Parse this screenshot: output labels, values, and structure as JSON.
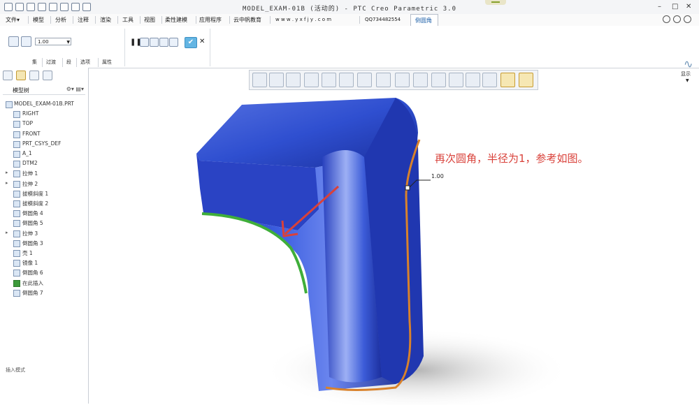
{
  "window": {
    "title": "MODEL_EXAM-01B (活动的) - PTC Creo Parametric 3.0",
    "controls": [
      "–",
      "□",
      "✕"
    ]
  },
  "menu": {
    "items": [
      "文件▾",
      "模型",
      "分析",
      "注释",
      "渲染",
      "工具",
      "视图",
      "柔性建模",
      "应用程序",
      "云中帆教育",
      "w w w . y x f j y . c o m",
      "QQ734482554"
    ],
    "active_tab": "倒圆角"
  },
  "ribbon": {
    "value_dropdown": "1.00",
    "tabs": [
      "集",
      "过渡",
      "段",
      "选项",
      "属性"
    ],
    "glasses_label": "显示",
    "confirm_symbol": "✔",
    "cancel_symbol": "✕",
    "pause_symbol": "❚❚"
  },
  "model_tree": {
    "title": "模型树",
    "items": [
      {
        "label": "MODEL_EXAM-01B.PRT",
        "expander": "",
        "icon": "part-icon"
      },
      {
        "label": "RIGHT",
        "expander": "",
        "icon": "datum-plane-icon"
      },
      {
        "label": "TOP",
        "expander": "",
        "icon": "datum-plane-icon"
      },
      {
        "label": "FRONT",
        "expander": "",
        "icon": "datum-plane-icon"
      },
      {
        "label": "PRT_CSYS_DEF",
        "expander": "",
        "icon": "csys-icon"
      },
      {
        "label": "A_1",
        "expander": "",
        "icon": "axis-icon"
      },
      {
        "label": "DTM2",
        "expander": "",
        "icon": "datum-plane-icon"
      },
      {
        "label": "拉伸 1",
        "expander": "▸",
        "icon": "extrude-icon"
      },
      {
        "label": "拉伸 2",
        "expander": "▸",
        "icon": "extrude-icon"
      },
      {
        "label": "拔模斜度 1",
        "expander": "",
        "icon": "draft-icon"
      },
      {
        "label": "拔模斜度 2",
        "expander": "",
        "icon": "draft-icon"
      },
      {
        "label": "倒圆角 4",
        "expander": "",
        "icon": "round-icon"
      },
      {
        "label": "倒圆角 5",
        "expander": "",
        "icon": "round-icon"
      },
      {
        "label": "拉伸 3",
        "expander": "▸",
        "icon": "extrude-icon"
      },
      {
        "label": "倒圆角 3",
        "expander": "",
        "icon": "round-icon"
      },
      {
        "label": "壳 1",
        "expander": "",
        "icon": "shell-icon"
      },
      {
        "label": "镜像 1",
        "expander": "",
        "icon": "mirror-icon"
      },
      {
        "label": "倒圆角 6",
        "expander": "",
        "icon": "round-icon"
      },
      {
        "label": "在此插入",
        "expander": "",
        "icon": "insert-arrow-icon"
      },
      {
        "label": "倒圆角 7",
        "expander": "",
        "icon": "round-icon"
      }
    ]
  },
  "status": {
    "note": "插入模式"
  },
  "viewport": {
    "annotation": "再次圆角，半径为1，参考如图。",
    "dimension": "1.00",
    "colors": {
      "model_blue": "#2f4fd0",
      "highlight_green": "#3fae3a",
      "edge_orange": "#d9822b",
      "annotation_red": "#d9413a",
      "accent": "#63b5e3"
    }
  }
}
